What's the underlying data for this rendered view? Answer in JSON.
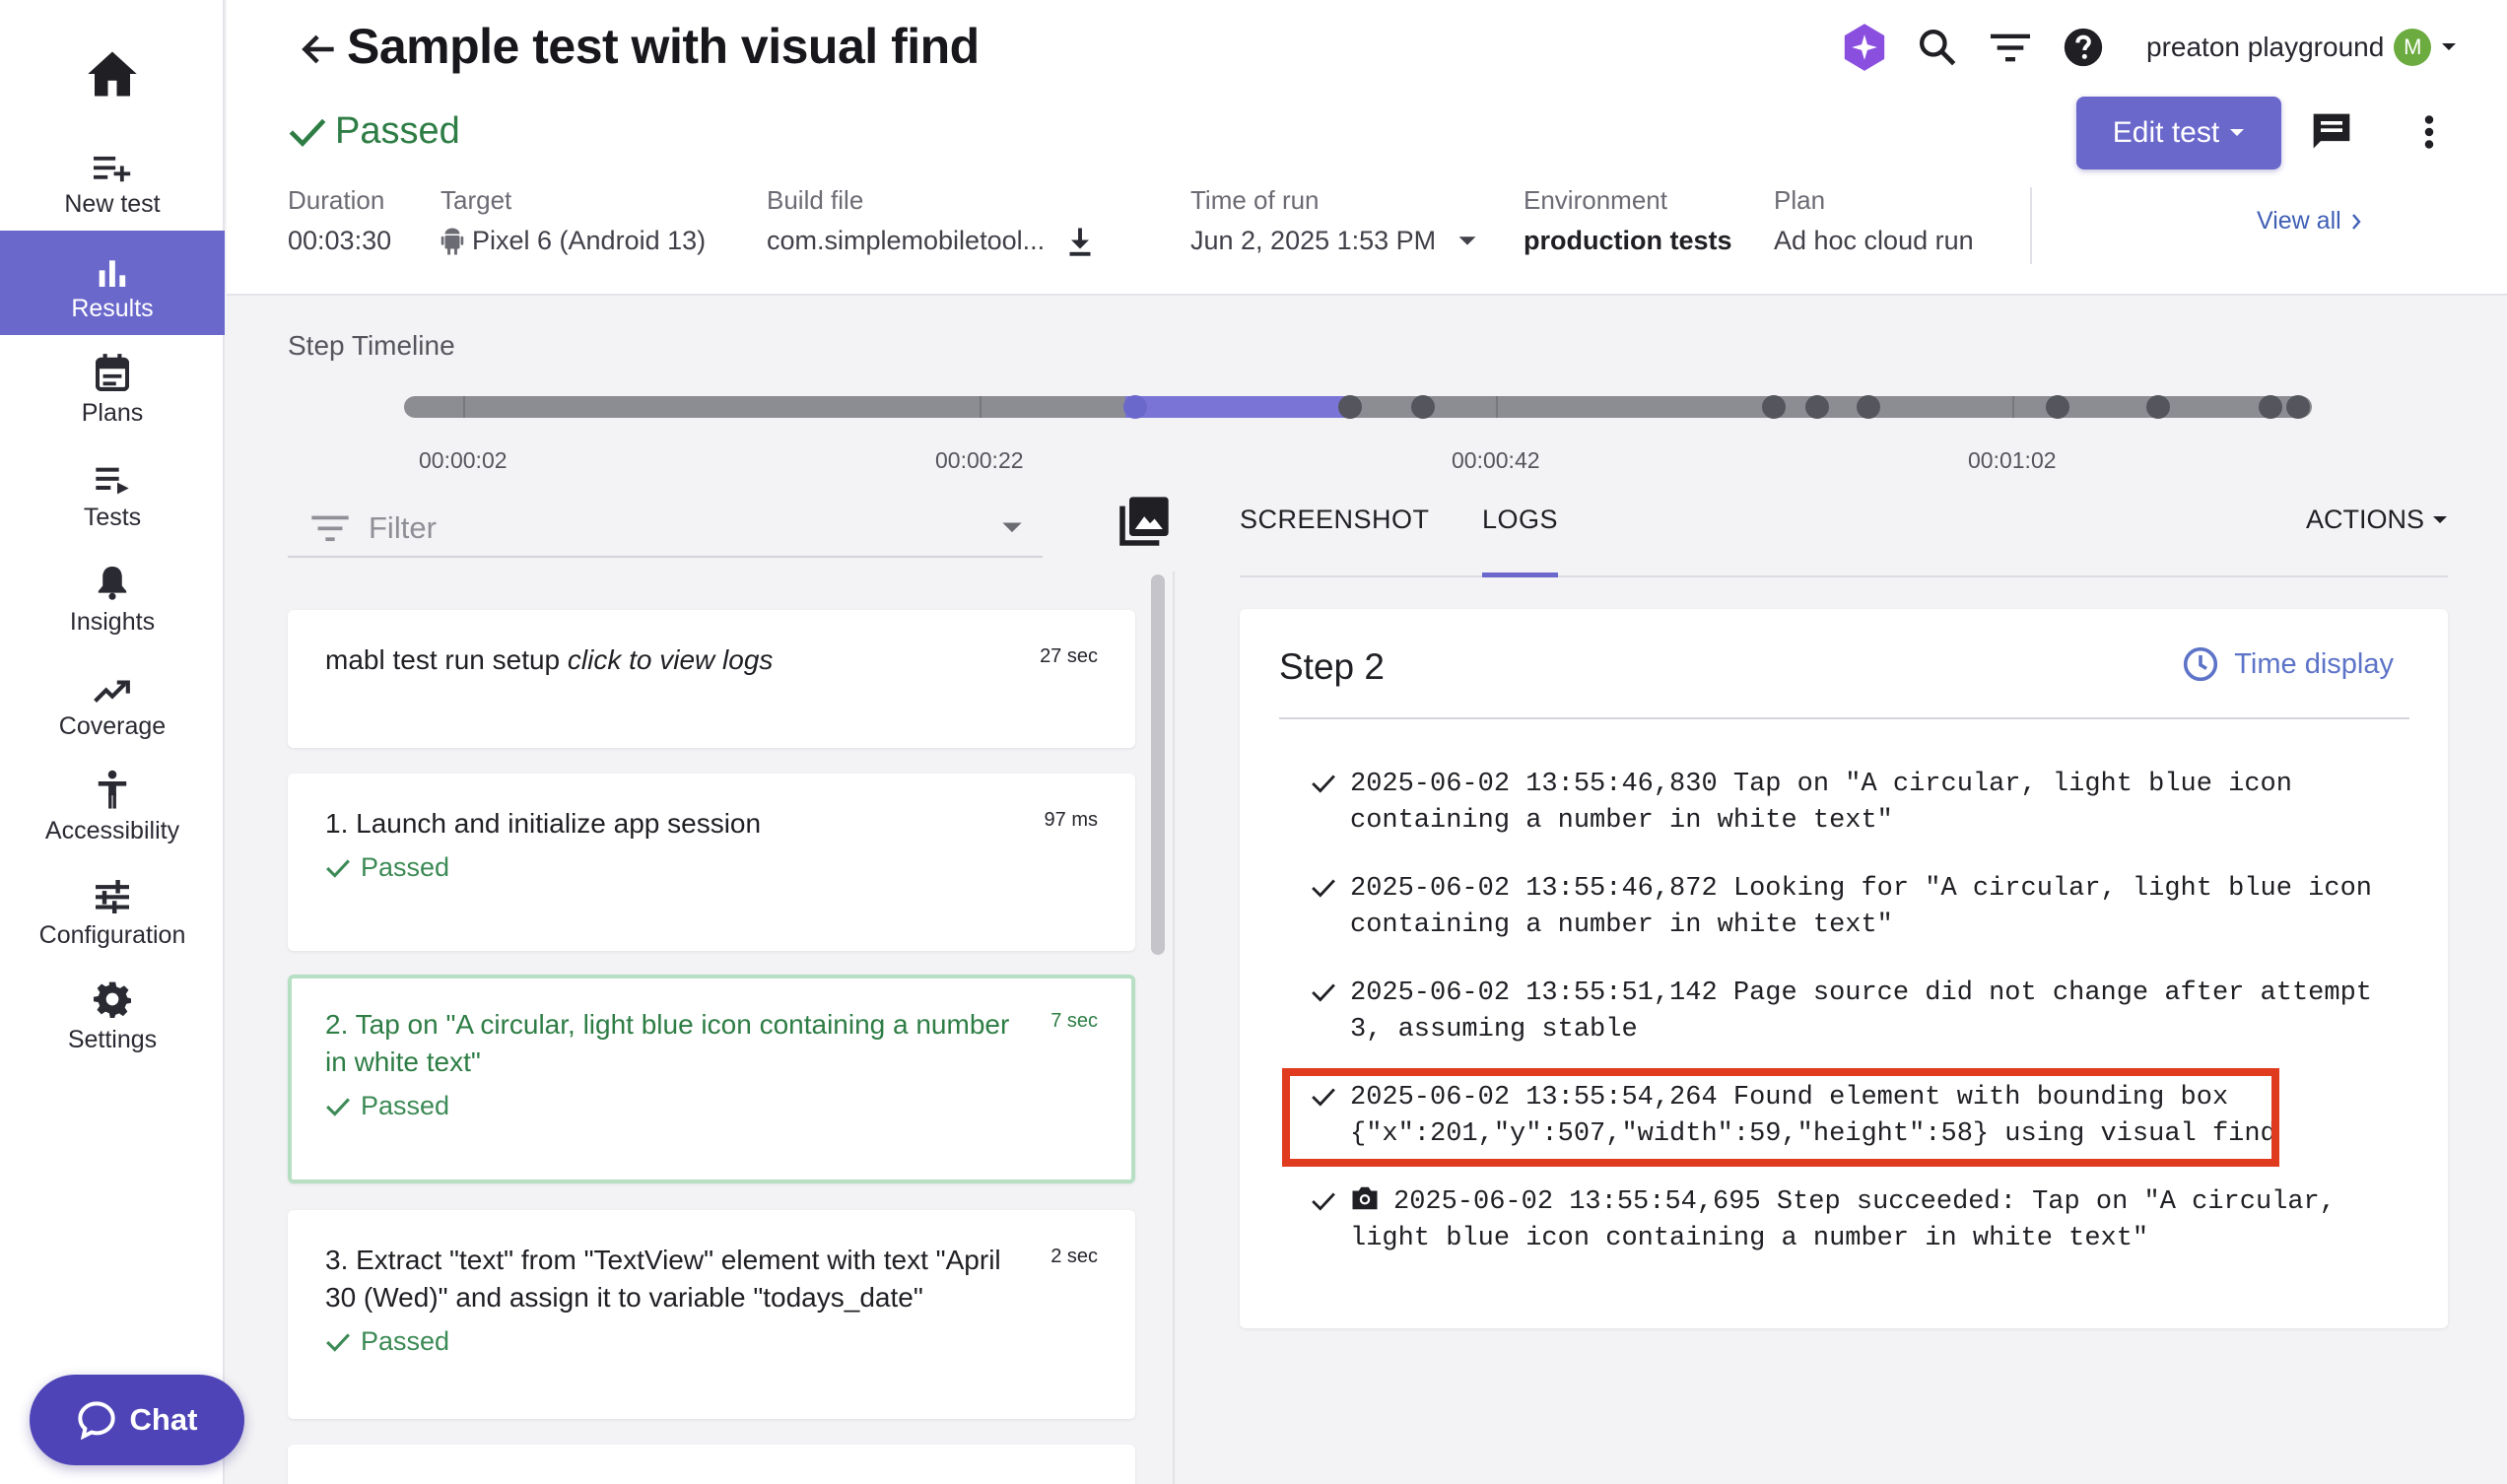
{
  "sidebar": {
    "items": [
      {
        "label": "New test",
        "icon": "new-test-icon"
      },
      {
        "label": "Results",
        "icon": "results-icon",
        "active": true
      },
      {
        "label": "Plans",
        "icon": "plans-icon"
      },
      {
        "label": "Tests",
        "icon": "tests-icon"
      },
      {
        "label": "Insights",
        "icon": "insights-icon"
      },
      {
        "label": "Coverage",
        "icon": "coverage-icon"
      },
      {
        "label": "Accessibility",
        "icon": "accessibility-icon"
      },
      {
        "label": "Configuration",
        "icon": "configuration-icon"
      },
      {
        "label": "Settings",
        "icon": "settings-icon"
      }
    ],
    "chat_label": "Chat"
  },
  "header": {
    "title": "Sample test with visual find",
    "status": "Passed",
    "workspace": "preaton playground",
    "avatar_initial": "M",
    "edit_label": "Edit test",
    "meta": {
      "duration": {
        "label": "Duration",
        "value": "00:03:30"
      },
      "target": {
        "label": "Target",
        "value": "Pixel 6 (Android 13)"
      },
      "build": {
        "label": "Build file",
        "value": "com.simplemobiletool..."
      },
      "time": {
        "label": "Time of run",
        "value": "Jun 2, 2025 1:53 PM"
      },
      "environment": {
        "label": "Environment",
        "value": "production tests"
      },
      "plan": {
        "label": "Plan",
        "value": "Ad hoc cloud run"
      }
    },
    "view_all": "View all"
  },
  "timeline": {
    "title": "Step Timeline",
    "labels": [
      "00:00:02",
      "00:00:22",
      "00:00:42",
      "00:01:02"
    ]
  },
  "steps": {
    "filter_placeholder": "Filter",
    "items": [
      {
        "title": "mabl test run setup",
        "title_link": "click to view logs",
        "duration": "27 sec",
        "status": ""
      },
      {
        "title": "1. Launch and initialize app session",
        "duration": "97 ms",
        "status": "Passed"
      },
      {
        "title": "2. Tap on \"A circular, light blue icon containing a number in white text\"",
        "duration": "7 sec",
        "status": "Passed"
      },
      {
        "title": "3. Extract \"text\" from \"TextView\" element with text \"April 30 (Wed)\" and assign it to variable \"todays_date\"",
        "duration": "2 sec",
        "status": "Passed"
      }
    ]
  },
  "detail": {
    "tabs": [
      "SCREENSHOT",
      "LOGS"
    ],
    "active_tab": "LOGS",
    "actions_label": "ACTIONS",
    "step_title": "Step 2",
    "time_display": "Time display",
    "logs": [
      "2025-06-02 13:55:46,830 Tap on \"A circular, light blue icon\ncontaining a number in white text\"",
      "2025-06-02 13:55:46,872 Looking for \"A circular, light blue icon\ncontaining a number in white text\"",
      "2025-06-02 13:55:51,142 Page source did not change after attempt\n3, assuming stable",
      "2025-06-02 13:55:54,264 Found element with bounding box\n{\"x\":201,\"y\":507,\"width\":59,\"height\":58} using visual find",
      "2025-06-02 13:55:54,695 Step succeeded: Tap on \"A circular,\nlight blue icon containing a number in white text\""
    ]
  },
  "colors": {
    "accent": "#6b68cc",
    "passed": "#2e7d45",
    "highlight": "#e03a1f",
    "chat": "#4e44b7"
  }
}
